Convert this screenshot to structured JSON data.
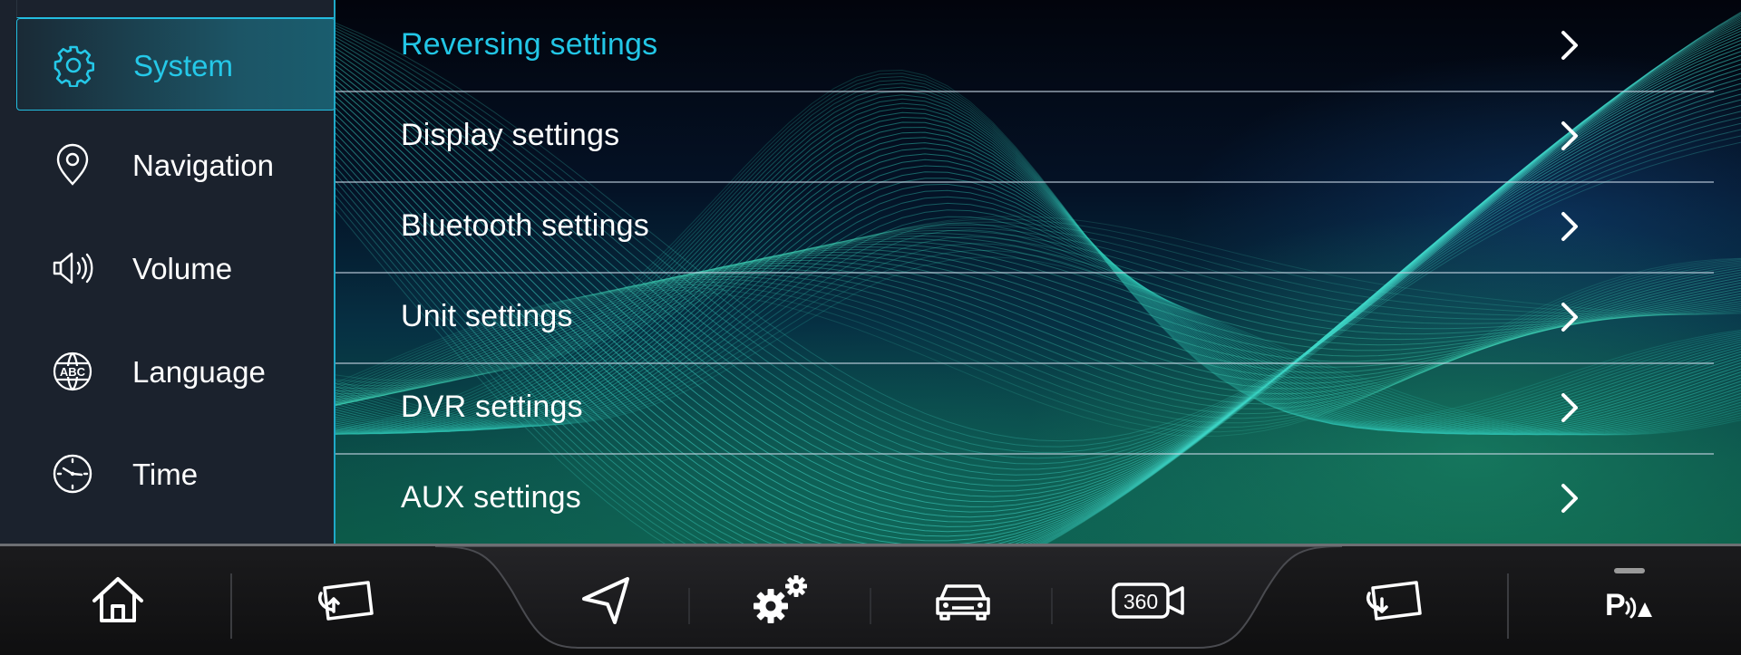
{
  "sidebar": {
    "items": [
      {
        "label": "System",
        "icon": "gear-icon",
        "active": true
      },
      {
        "label": "Navigation",
        "icon": "map-pin-icon",
        "active": false
      },
      {
        "label": "Volume",
        "icon": "speaker-icon",
        "active": false
      },
      {
        "label": "Language",
        "icon": "abc-globe-icon",
        "active": false
      },
      {
        "label": "Time",
        "icon": "clock-icon",
        "active": false
      }
    ]
  },
  "settings_menu": {
    "items": [
      {
        "label": "Reversing settings",
        "active": true
      },
      {
        "label": "Display settings",
        "active": false
      },
      {
        "label": "Bluetooth settings",
        "active": false
      },
      {
        "label": "Unit settings",
        "active": false
      },
      {
        "label": "DVR settings",
        "active": false
      },
      {
        "label": "AUX settings",
        "active": false
      }
    ]
  },
  "dock": {
    "buttons": [
      {
        "icon": "home-icon"
      },
      {
        "icon": "screen-cast-up-icon"
      },
      {
        "icon": "navigation-arrow-icon"
      },
      {
        "icon": "settings-gears-icon"
      },
      {
        "icon": "car-icon"
      },
      {
        "icon": "camera-360-icon",
        "label": "360"
      },
      {
        "icon": "screen-cast-back-icon"
      },
      {
        "icon": "parking-sensor-icon",
        "label": "P"
      }
    ]
  },
  "colors": {
    "accent": "#22c6e6",
    "sidebar_bg": "#1b222d",
    "dock_bg": "#141415",
    "text": "#ffffff"
  }
}
